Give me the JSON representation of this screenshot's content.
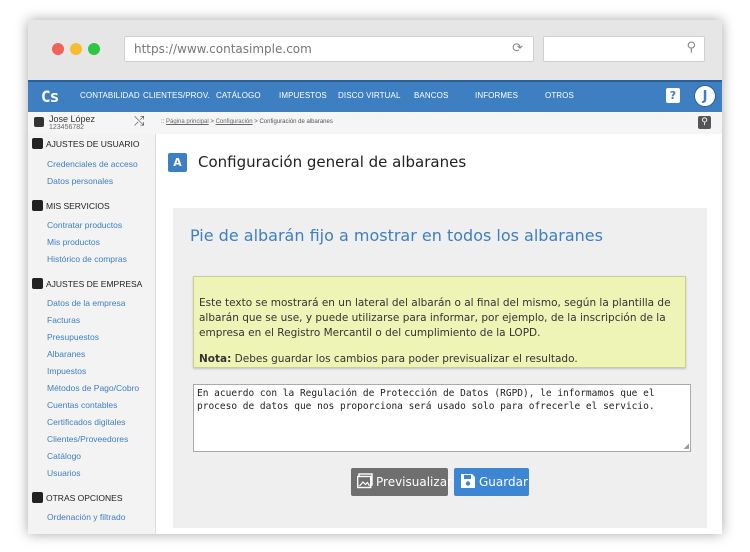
{
  "browser": {
    "url": "https://www.contasimple.com",
    "dots": [
      "#f26157",
      "#f7bd2e",
      "#2ac840"
    ]
  },
  "nav": {
    "logo": "Cs",
    "items": [
      "CONTABILIDAD",
      "CLIENTES/PROV.",
      "CATÁLOGO",
      "IMPUESTOS",
      "DISCO VIRTUAL",
      "BANCOS",
      "INFORMES",
      "OTROS"
    ],
    "help": "?",
    "avatar": "J"
  },
  "user": {
    "name": "Jose López",
    "number": "123456782"
  },
  "breadcrumb": {
    "sep": "::",
    "home": "Página principal",
    "config": "Configuración",
    "current": "Configuración de albaranes"
  },
  "sidebar": {
    "sections": [
      {
        "title": "AJUSTES DE USUARIO",
        "links": [
          "Credenciales de acceso",
          "Datos personales"
        ]
      },
      {
        "title": "MIS SERVICIOS",
        "links": [
          "Contratar productos",
          "Mis productos",
          "Histórico de compras"
        ]
      },
      {
        "title": "AJUSTES DE EMPRESA",
        "links": [
          "Datos de la empresa",
          "Facturas",
          "Presupuestos",
          "Albaranes",
          "Impuestos",
          "Métodos de Pago/Cobro",
          "Cuentas contables",
          "Certificados digitales",
          "Clientes/Proveedores",
          "Catálogo",
          "Usuarios"
        ]
      },
      {
        "title": "OTRAS OPCIONES",
        "links": [
          "Ordenación y filtrado"
        ]
      }
    ]
  },
  "main": {
    "title": "Configuración general de albaranes",
    "panel_title": "Pie de albarán fijo a mostrar en todos los albaranes",
    "info": "Este texto se mostrará en un lateral del albarán o al final del mismo, según la plantilla de albarán que se use, y puede utilizarse para informar, por ejemplo, de la inscripción de la empresa en el Registro Mercantil o del cumplimiento de la LOPD.",
    "note_label": "Nota:",
    "note_text": "Debes guardar los cambios para poder previsualizar el resultado.",
    "footer_text": "En acuerdo con la Regulación de Protección de Datos (RGPD), le informamos que el proceso de datos que nos proporciona será usado solo para ofrecerle el servicio.",
    "preview_label": "Previsualizar",
    "save_label": "Guardar"
  },
  "colors": {
    "accent": "#3d7fc1",
    "note_bg": "#eef4b6"
  }
}
